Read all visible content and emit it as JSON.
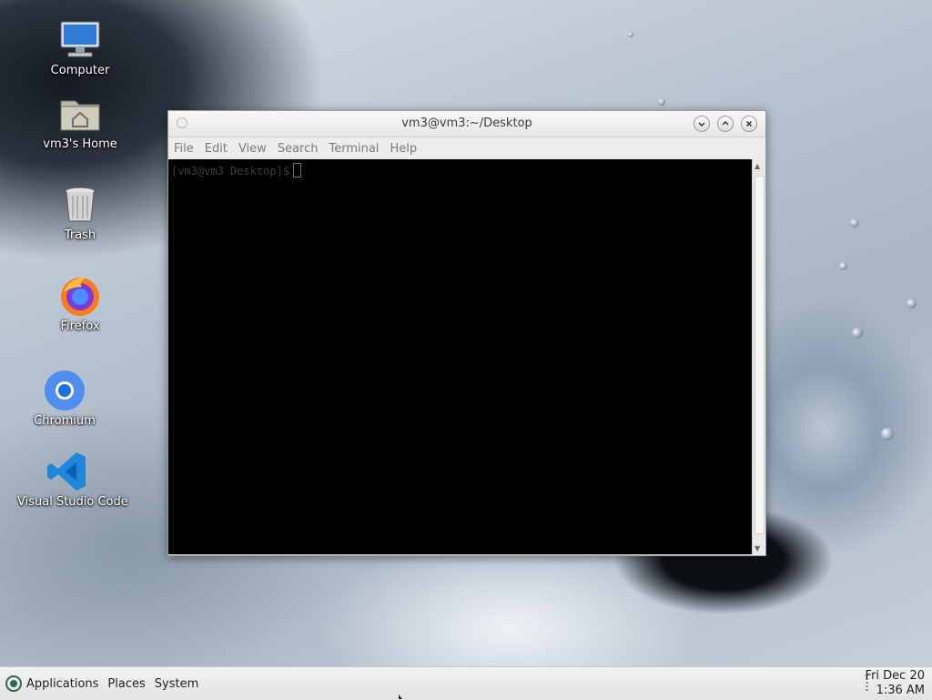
{
  "desktop": {
    "icons": [
      {
        "label": "Computer",
        "icon": "computer-icon"
      },
      {
        "label": "vm3's Home",
        "icon": "home-folder-icon"
      },
      {
        "label": "Trash",
        "icon": "trash-icon"
      },
      {
        "label": "Firefox",
        "icon": "firefox-icon"
      },
      {
        "label": "Chromium",
        "icon": "chromium-icon"
      },
      {
        "label": "Visual Studio Code",
        "icon": "vscode-icon"
      }
    ]
  },
  "window": {
    "title": "vm3@vm3:~/Desktop",
    "menu": [
      "File",
      "Edit",
      "View",
      "Search",
      "Terminal",
      "Help"
    ],
    "buttons": {
      "minimize": "minimize-icon",
      "maximize": "maximize-icon",
      "close": "close-icon"
    },
    "prompt": "[vm3@vm3 Desktop]$"
  },
  "panel": {
    "menus": [
      "Applications",
      "Places",
      "System"
    ],
    "date": "Fri Dec 20",
    "time": "1:36 AM"
  },
  "colors": {
    "terminal_bg": "#000000",
    "panel_bg": "#ececec"
  }
}
